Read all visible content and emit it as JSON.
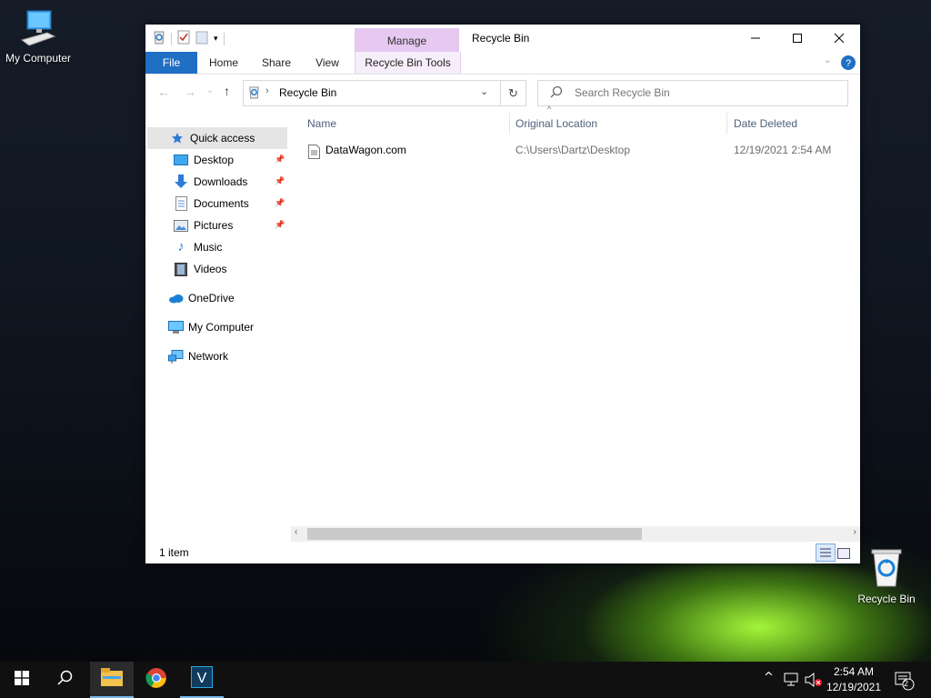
{
  "desktop": {
    "icons": [
      {
        "label": "My Computer",
        "icon": "monitor-icon"
      },
      {
        "label": "Recycle Bin",
        "icon": "recycle-bin-icon"
      }
    ]
  },
  "window": {
    "title": "Recycle Bin",
    "contextual_tab_group": "Manage",
    "ribbon_tabs": {
      "file": "File",
      "home": "Home",
      "share": "Share",
      "view": "View",
      "tools": "Recycle Bin Tools"
    },
    "address": {
      "path": "Recycle Bin"
    },
    "search": {
      "placeholder": "Search Recycle Bin"
    },
    "nav": {
      "quick_access": "Quick access",
      "items": [
        "Desktop",
        "Downloads",
        "Documents",
        "Pictures",
        "Music",
        "Videos"
      ],
      "onedrive": "OneDrive",
      "my_computer": "My Computer",
      "network": "Network"
    },
    "columns": {
      "name": "Name",
      "location": "Original Location",
      "date": "Date Deleted"
    },
    "files": [
      {
        "name": "DataWagon.com",
        "location": "C:\\Users\\Dartz\\Desktop",
        "date": "12/19/2021 2:54 AM"
      }
    ],
    "status": {
      "count": "1 item"
    }
  },
  "taskbar": {
    "clock": {
      "time": "2:54 AM",
      "date": "12/19/2021"
    },
    "notification_count": "2"
  },
  "colors": {
    "accent": "#1f6fc5",
    "manage_tab": "#e6c8f0",
    "taskbar": "#101010"
  }
}
